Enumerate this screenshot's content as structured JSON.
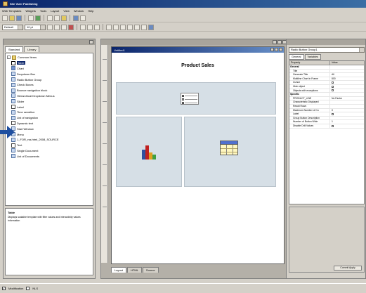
{
  "window": {
    "title": "Site Vizer Publishing"
  },
  "menu": [
    "Web Templates",
    "Widgets",
    "Tools",
    "Layout",
    "View",
    "Window",
    "Help"
  ],
  "toolbar": {
    "font_value": "Default",
    "size_value": "10 pt"
  },
  "left_panel": {
    "tabs": [
      "Standard",
      "Library"
    ],
    "active_tab": "Standard",
    "tree": [
      {
        "label": "Common Items",
        "level": 0,
        "icon": "folder-icon",
        "expander": "-"
      },
      {
        "label": "Table",
        "level": 1,
        "icon": "table-icon",
        "selected": true
      },
      {
        "label": "Chart",
        "level": 1,
        "icon": "chart-icon"
      },
      {
        "label": "Dropdown Box",
        "level": 1,
        "icon": "dropdown-icon"
      },
      {
        "label": "Radio Button Group",
        "level": 1,
        "icon": "radio-icon"
      },
      {
        "label": "Check Boxes",
        "level": 1,
        "icon": "checkbox-icon"
      },
      {
        "label": "Bounce navigation block",
        "level": 1,
        "icon": "nav-icon"
      },
      {
        "label": "Hierarchical Dropdown Menus",
        "level": 1,
        "icon": "menu-icon"
      },
      {
        "label": "Slider",
        "level": 1,
        "icon": "slider-icon"
      },
      {
        "label": "Label",
        "level": 1,
        "icon": "text-icon"
      },
      {
        "label": "Time sensitive",
        "level": 1,
        "icon": "clock-icon"
      },
      {
        "label": "List of navigation",
        "level": 1,
        "icon": "list-icon"
      },
      {
        "label": "Dynamic text",
        "level": 1,
        "icon": "text-icon"
      },
      {
        "label": "Start Window",
        "level": 1,
        "icon": "window-icon"
      },
      {
        "label": "Menu",
        "level": 1,
        "icon": "menu-icon"
      },
      {
        "label": "1_FOR_rss.html_2008_SOURCE",
        "level": 1,
        "icon": "file-icon"
      },
      {
        "label": "Text",
        "level": 1,
        "icon": "text-icon"
      },
      {
        "label": "Single Document",
        "level": 1,
        "icon": "document-icon"
      },
      {
        "label": "List of Documents",
        "level": 1,
        "icon": "documents-icon"
      }
    ],
    "description": {
      "title": "Table",
      "text": "Displays scalable template with filter values and interactivity values information"
    }
  },
  "document": {
    "window_title": "Untitled1",
    "report_title": "Product Sales",
    "tabs": [
      "Layout",
      "HTML",
      "Source"
    ],
    "active_tab": "Layout"
  },
  "right_panel": {
    "object_combo": "Radio Button Group1",
    "tabs": [
      "General",
      "Variables"
    ],
    "active_tab": "General",
    "columns": [
      "Property",
      "Value"
    ],
    "properties": [
      {
        "name": "General",
        "value": "",
        "category": true
      },
      {
        "name": "Title",
        "value": ""
      },
      {
        "name": "Generate Title",
        "value": "All"
      },
      {
        "name": "Multiline Chart in Frame",
        "value": "800"
      },
      {
        "name": "Cursor",
        "value": "",
        "checkbox": true
      },
      {
        "name": "Hide object",
        "value": "",
        "checkbox": true
      },
      {
        "name": "Objects with exceptions",
        "value": "",
        "checkbox": true
      },
      {
        "name": "Specific",
        "value": "",
        "category": true
      },
      {
        "name": "PRODUCT_LINE",
        "value": "No Factor"
      },
      {
        "name": "Characteristic Displayed",
        "value": ""
      },
      {
        "name": "Result Rows",
        "value": ""
      },
      {
        "name": "Maximum Number of Co",
        "value": "0"
      },
      {
        "name": "Label",
        "value": "",
        "checkbox": true
      },
      {
        "name": "Group Button Description",
        "value": ""
      },
      {
        "name": "Number of Button Wide",
        "value": "1"
      },
      {
        "name": "Disable Drill Values",
        "value": "",
        "checkbox": true
      }
    ],
    "button_label": "Commit Apply"
  },
  "statusbar": {
    "item1": "Modification",
    "item2": "NLS"
  }
}
